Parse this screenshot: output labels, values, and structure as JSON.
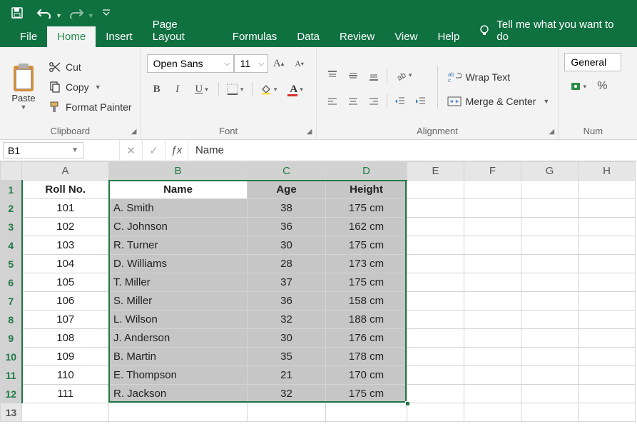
{
  "qat": {
    "undo_tip": "Undo",
    "redo_tip": "Redo",
    "save_tip": "Save"
  },
  "tabs": {
    "file": "File",
    "home": "Home",
    "insert": "Insert",
    "page_layout": "Page Layout",
    "formulas": "Formulas",
    "data": "Data",
    "review": "Review",
    "view": "View",
    "help": "Help",
    "tell_me": "Tell me what you want to do"
  },
  "ribbon": {
    "clipboard": {
      "paste": "Paste",
      "cut": "Cut",
      "copy": "Copy",
      "format_painter": "Format Painter",
      "group": "Clipboard"
    },
    "font": {
      "name": "Open Sans",
      "size": "11",
      "group": "Font",
      "bold": "B",
      "italic": "I",
      "underline": "U"
    },
    "alignment": {
      "wrap": "Wrap Text",
      "merge": "Merge & Center",
      "group": "Alignment"
    },
    "number": {
      "format": "General",
      "group": "Num"
    }
  },
  "namebox": "B1",
  "formula": "Name",
  "columns": [
    "A",
    "B",
    "C",
    "D",
    "E",
    "F",
    "G",
    "H"
  ],
  "rows": [
    "1",
    "2",
    "3",
    "4",
    "5",
    "6",
    "7",
    "8",
    "9",
    "10",
    "11",
    "12",
    "13"
  ],
  "headers": {
    "A": "Roll No.",
    "B": "Name",
    "C": "Age",
    "D": "Height"
  },
  "chart_data": {
    "type": "table",
    "columns": [
      "Roll No.",
      "Name",
      "Age",
      "Height"
    ],
    "rows": [
      {
        "roll": "101",
        "name": "A. Smith",
        "age": "38",
        "height": "175 cm"
      },
      {
        "roll": "102",
        "name": "C. Johnson",
        "age": "36",
        "height": "162 cm"
      },
      {
        "roll": "103",
        "name": "R. Turner",
        "age": "30",
        "height": "175 cm"
      },
      {
        "roll": "104",
        "name": "D. Williams",
        "age": "28",
        "height": "173 cm"
      },
      {
        "roll": "105",
        "name": "T. Miller",
        "age": "37",
        "height": "175 cm"
      },
      {
        "roll": "106",
        "name": "S. Miller",
        "age": "36",
        "height": "158 cm"
      },
      {
        "roll": "107",
        "name": "L. Wilson",
        "age": "32",
        "height": "188 cm"
      },
      {
        "roll": "108",
        "name": "J. Anderson",
        "age": "30",
        "height": "176 cm"
      },
      {
        "roll": "109",
        "name": "B. Martin",
        "age": "35",
        "height": "178 cm"
      },
      {
        "roll": "110",
        "name": "E. Thompson",
        "age": "21",
        "height": "170 cm"
      },
      {
        "roll": "111",
        "name": "R. Jackson",
        "age": "32",
        "height": "175 cm"
      }
    ]
  }
}
